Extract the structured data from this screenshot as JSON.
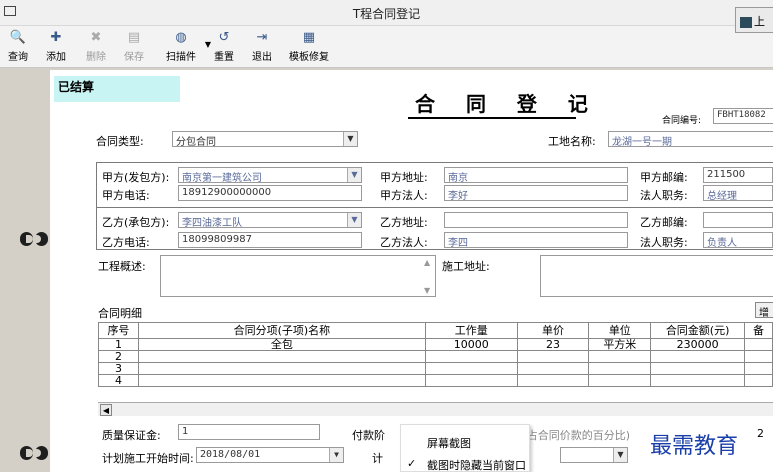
{
  "window": {
    "title": "T程合同登记"
  },
  "toolbar": [
    {
      "name": "query-button",
      "icon": "query-icon",
      "label": "查询",
      "enabled": true
    },
    {
      "name": "add-button",
      "icon": "add-icon",
      "label": "添加",
      "enabled": true
    },
    {
      "name": "delete-button",
      "icon": "delete-icon",
      "label": "删除",
      "enabled": false
    },
    {
      "name": "save-button",
      "icon": "save-icon",
      "label": "保存",
      "enabled": false
    },
    {
      "name": "scan-button",
      "icon": "scan-icon",
      "label": "扫描件",
      "enabled": true
    },
    {
      "name": "reset-button",
      "icon": "reset-icon",
      "label": "重置",
      "enabled": true
    },
    {
      "name": "exit-button",
      "icon": "exit-icon",
      "label": "退出",
      "enabled": true
    },
    {
      "name": "template-button",
      "icon": "template-icon",
      "label": "模板修复",
      "enabled": true
    }
  ],
  "topright": {
    "label": "上"
  },
  "form": {
    "status": "已结算",
    "heading": "合 同 登 记",
    "contract_no_label": "合同编号:",
    "contract_no": "FBHT18082",
    "contract_type_label": "合同类型:",
    "contract_type": "分包合同",
    "site_label": "工地名称:",
    "site": "龙湖一号一期",
    "party_a": {
      "label": "甲方(发包方):",
      "value": "南京第一建筑公司",
      "phone_label": "甲方电话:",
      "phone": "18912900000000",
      "addr_label": "甲方地址:",
      "addr": "南京",
      "rep_label": "甲方法人:",
      "rep": "李好",
      "zip_label": "甲方邮编:",
      "zip": "211500",
      "title_label": "法人职务:",
      "title": "总经理"
    },
    "party_b": {
      "label": "乙方(承包方):",
      "value": "李四油漆工队",
      "phone_label": "乙方电话:",
      "phone": "18099809987",
      "addr_label": "乙方地址:",
      "addr": "",
      "rep_label": "乙方法人:",
      "rep": "李四",
      "zip_label": "乙方邮编:",
      "zip": "",
      "title_label": "法人职务:",
      "title": "负责人"
    },
    "overview_label": "工程概述:",
    "construction_addr_label": "施工地址:",
    "detail_label": "合同明细",
    "detail_right": "增",
    "table": {
      "headers": [
        "序号",
        "合同分项(子项)名称",
        "工作量",
        "单价",
        "单位",
        "合同金额(元)",
        "备"
      ],
      "rows": [
        [
          "1",
          "全包",
          "10000",
          "23",
          "平方米",
          "230000",
          ""
        ],
        [
          "2",
          "",
          "",
          "",
          "",
          "",
          ""
        ],
        [
          "3",
          "",
          "",
          "",
          "",
          "",
          ""
        ],
        [
          "4",
          "",
          "",
          "",
          "",
          "",
          ""
        ]
      ]
    },
    "deposit_label": "质量保证金:",
    "deposit": "1",
    "payment_label": "付款阶",
    "payment_hint": "5 (占合同价款的百分比)",
    "start_label": "计划施工开始时间:",
    "start": "2018/08/01",
    "end_label": "计",
    "percent_right": "2"
  },
  "context_menu": {
    "item1": "屏幕截图",
    "item2": "截图时隐藏当前窗口",
    "check": "✓"
  },
  "watermark": "最需教育"
}
